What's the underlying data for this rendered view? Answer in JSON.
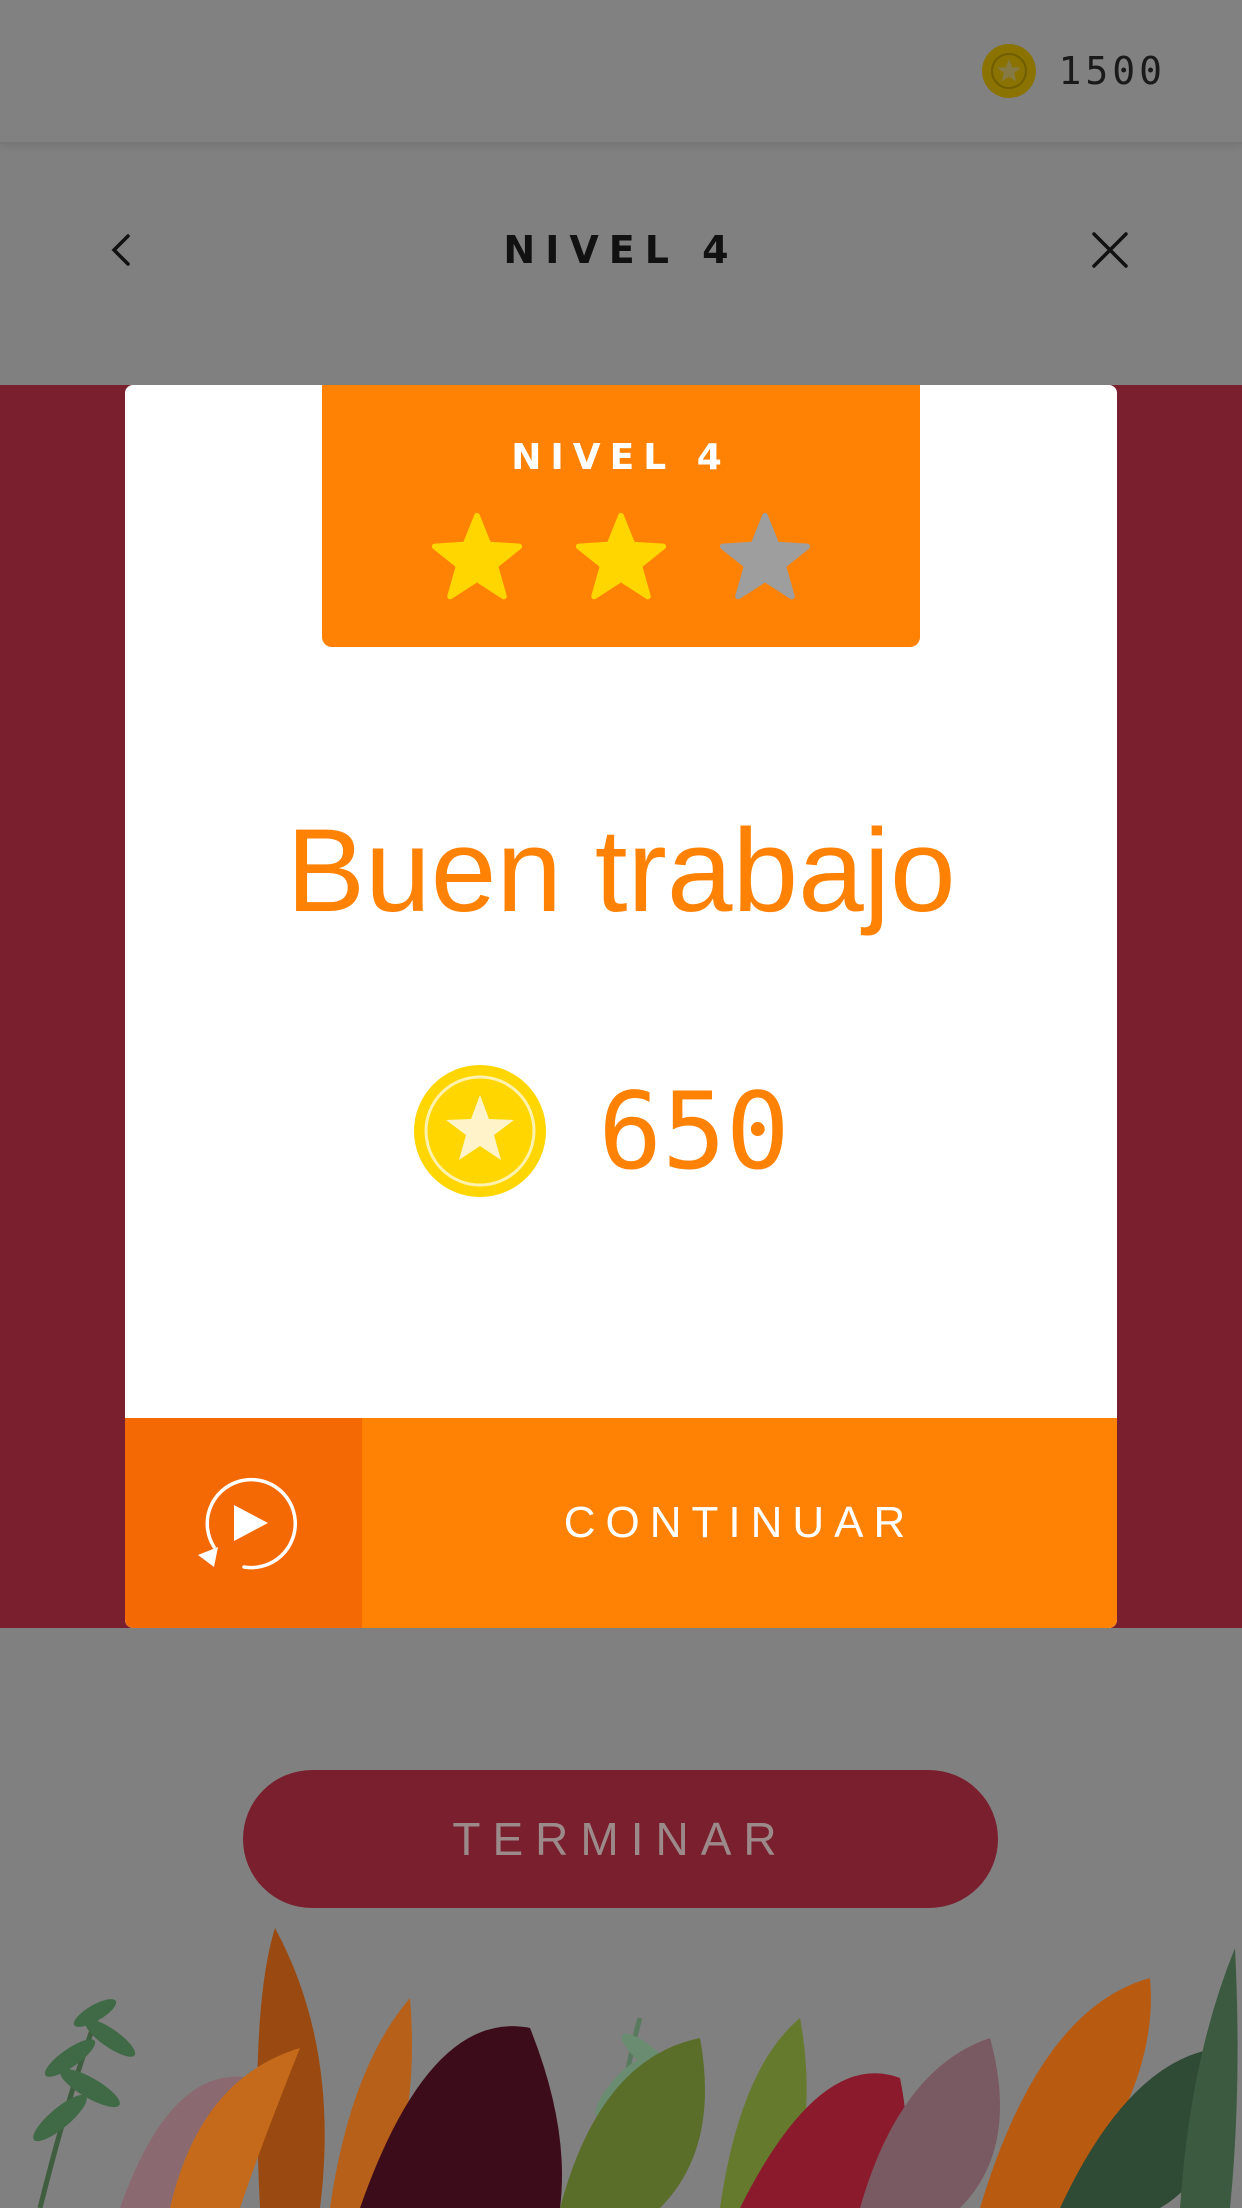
{
  "topbar": {
    "coins_icon": "coin-star-icon",
    "coins_value": "1500"
  },
  "header": {
    "title": "NIVEL 4",
    "back_icon": "chevron-left-icon",
    "close_icon": "close-icon"
  },
  "modal": {
    "badge_title": "NIVEL 4",
    "stars": {
      "earned": 2,
      "total": 3
    },
    "headline": "Buen trabajo",
    "reward_value": "650",
    "video_icon": "replay-video-icon",
    "continue_label": "CONTINUAR"
  },
  "finish_label": "TERMINAR",
  "colors": {
    "accent": "#ff8205",
    "accent_dark": "#f56905",
    "band": "#7a1f2e",
    "star_on": "#ffd600",
    "star_off": "#9e9e9e",
    "coin": "#ffd600"
  }
}
